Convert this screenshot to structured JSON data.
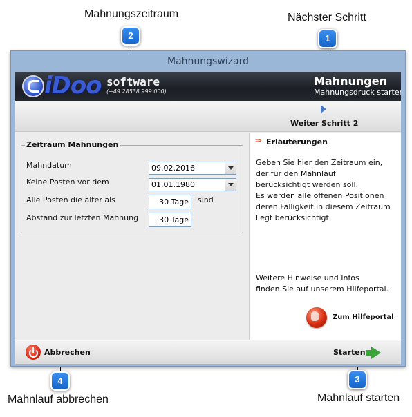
{
  "callouts": {
    "c1": {
      "number": "1",
      "label": "Nächster Schritt"
    },
    "c2": {
      "number": "2",
      "label": "Mahnungszeitraum"
    },
    "c3": {
      "number": "3",
      "label": "Mahnlauf starten"
    },
    "c4": {
      "number": "4",
      "label": "Mahnlauf abbrechen"
    }
  },
  "window": {
    "title": "Mahnungswizard"
  },
  "banner": {
    "logo_text": "iDoo",
    "brand": "software",
    "phone": "(+49 28538 999 000)",
    "title": "Mahnungen",
    "subtitle": "Mahnungsdruck starten"
  },
  "stepbar": {
    "next_label": "Weiter Schritt 2"
  },
  "form": {
    "legend": "Zeitraum Mahnungen",
    "mahndatum_label": "Mahndatum",
    "mahndatum_value": "09.02.2016",
    "keine_posten_label": "Keine Posten vor dem",
    "keine_posten_value": "01.01.1980",
    "aelter_label": "Alle Posten die älter als",
    "aelter_value": "30 Tage",
    "aelter_suffix": "sind",
    "abstand_label": "Abstand zur letzten Mahnung",
    "abstand_value": "30 Tage"
  },
  "info": {
    "title": "Erläuterungen",
    "text_lines": [
      "Geben Sie hier den Zeitraum ein,",
      "der für den Mahnlauf",
      "berücksichtigt werden soll.",
      "Es werden alle offenen Positionen",
      "deren Fälligkeit in diesem Zeitraum",
      "liegt berücksichtigt."
    ],
    "hint_lines": [
      "Weitere Hinweise und Infos",
      "finden Sie auf unserem Hilfeportal."
    ],
    "portal_link": "Zum Hilfeportal"
  },
  "footer": {
    "cancel_label": "Abbrechen",
    "start_label": "Starten"
  },
  "colors": {
    "window_frame": "#9bb7d8",
    "badge_blue": "#1f6fd8",
    "banner_dark": "#1b1e24",
    "start_green": "#3aa33a",
    "cancel_red": "#d8240f"
  }
}
